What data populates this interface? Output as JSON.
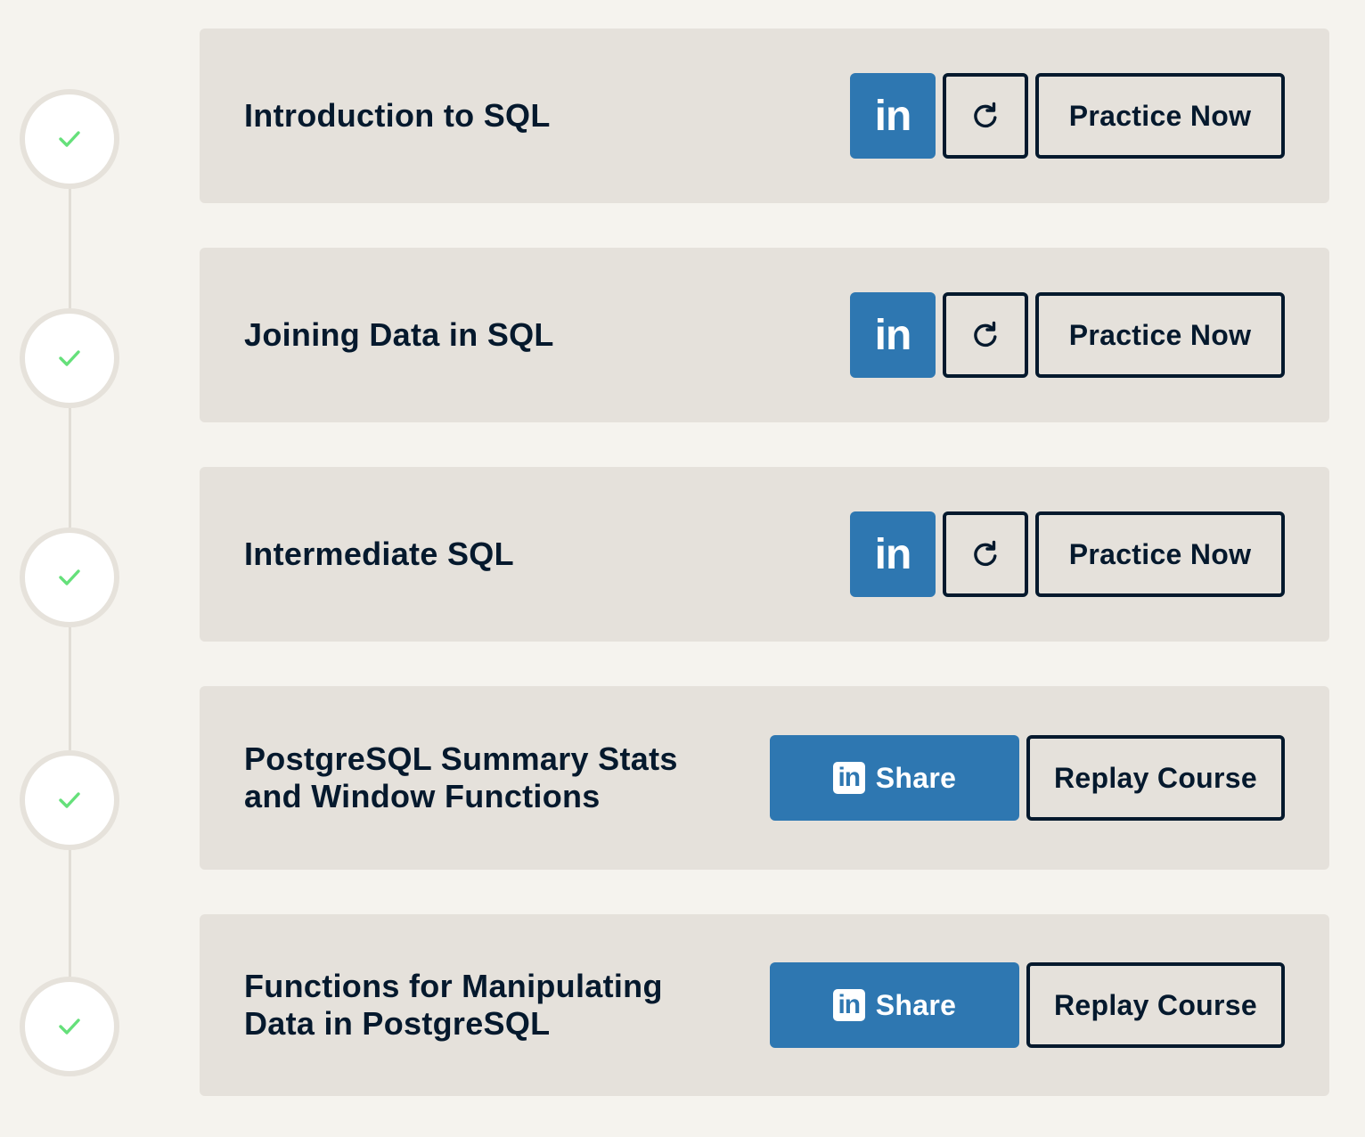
{
  "courses": [
    {
      "title": "Introduction to SQL",
      "completed": true,
      "linkedin_label": "in",
      "primary_action": "Practice Now",
      "icon_names": [
        "check-icon",
        "linkedin-icon",
        "refresh-icon"
      ]
    },
    {
      "title": "Joining Data in SQL",
      "completed": true,
      "linkedin_label": "in",
      "primary_action": "Practice Now",
      "icon_names": [
        "check-icon",
        "linkedin-icon",
        "refresh-icon"
      ]
    },
    {
      "title": "Intermediate SQL",
      "completed": true,
      "linkedin_label": "in",
      "primary_action": "Practice Now",
      "icon_names": [
        "check-icon",
        "linkedin-icon",
        "refresh-icon"
      ]
    },
    {
      "title": "PostgreSQL Summary Stats and Window Functions",
      "completed": true,
      "linkedin_label": "in",
      "share_label": "Share",
      "primary_action": "Replay Course",
      "icon_names": [
        "check-icon",
        "linkedin-icon"
      ]
    },
    {
      "title": "Functions for Manipulating Data in PostgreSQL",
      "completed": true,
      "linkedin_label": "in",
      "share_label": "Share",
      "primary_action": "Replay Course",
      "icon_names": [
        "check-icon",
        "linkedin-icon"
      ]
    }
  ],
  "colors": {
    "background": "#f5f3ee",
    "card": "#e5e1db",
    "linkedin_blue": "#2e77b1",
    "text_dark": "#05192d",
    "check_green": "#65e07a",
    "circle_border": "#e6e2db"
  }
}
